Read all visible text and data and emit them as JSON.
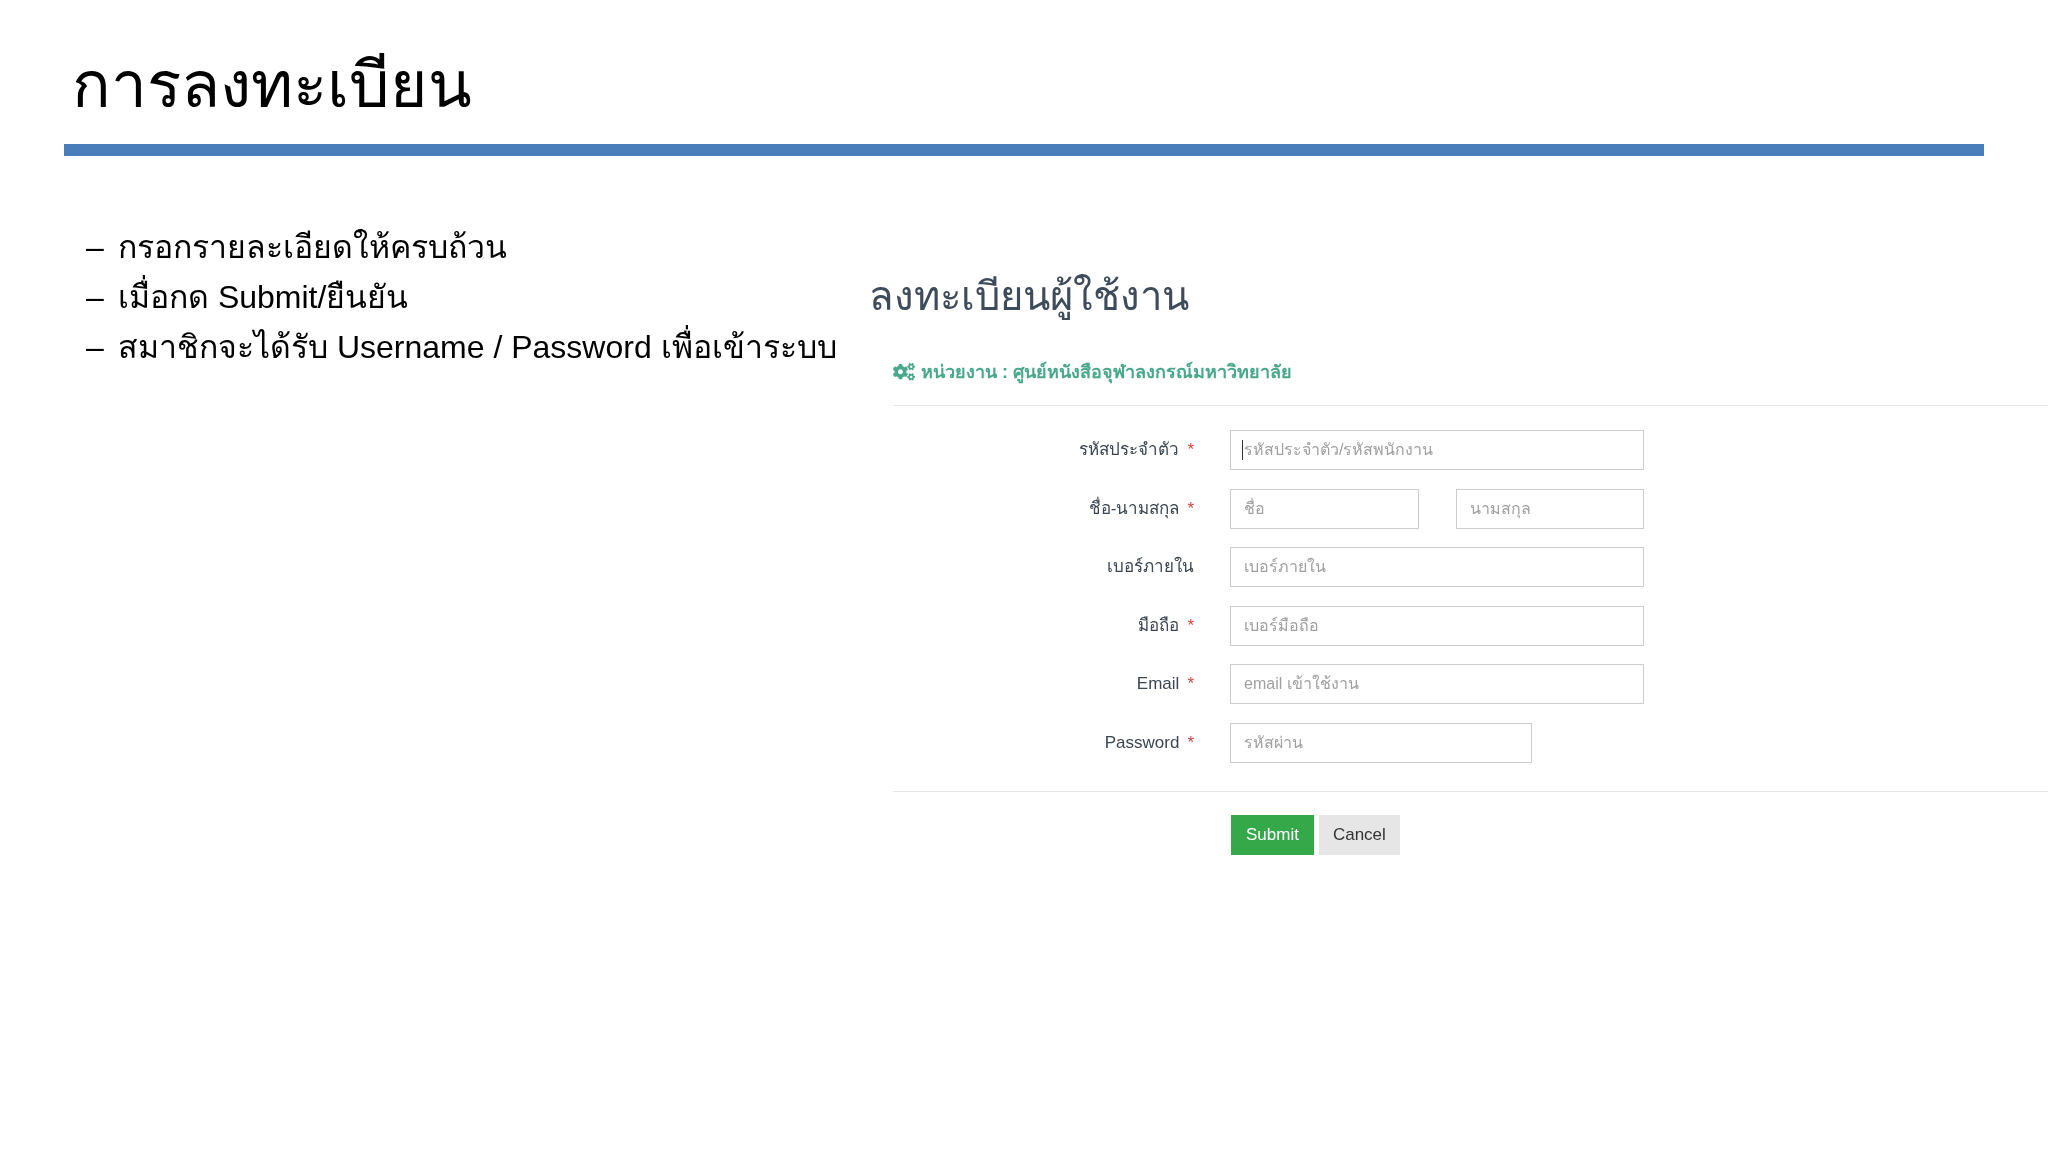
{
  "slide": {
    "title": "การลงทะเบียน"
  },
  "bullets": [
    {
      "marker": "–",
      "text": "กรอกรายละเอียดให้ครบถ้วน"
    },
    {
      "marker": "–",
      "text": "เมื่อกด Submit/ยืนยัน"
    },
    {
      "marker": "–",
      "text": "สมาชิกจะได้รับ Username / Password เพื่อเข้าระบบ"
    }
  ],
  "form": {
    "title": "ลงทะเบียนผู้ใช้งาน",
    "department": "หน่วยงาน : ศูนย์หนังสือจุฬาลงกรณ์มหาวิทยาลัย",
    "fields": [
      {
        "label": "รหัสประจำตัว",
        "required_mark": "*",
        "inputs": [
          {
            "kind": "text",
            "placeholder": "รหัสประจำตัว/รหัสพนักงาน",
            "focused": true
          }
        ]
      },
      {
        "label": "ชื่อ-นามสกุล",
        "required_mark": "*",
        "inputs": [
          {
            "kind": "text",
            "placeholder": "ชื่อ",
            "focused": false
          },
          {
            "kind": "text",
            "placeholder": "นามสกุล",
            "focused": false
          }
        ]
      },
      {
        "label": "เบอร์ภายใน",
        "inputs": [
          {
            "kind": "text",
            "placeholder": "เบอร์ภายใน",
            "focused": false
          }
        ]
      },
      {
        "label": "มือถือ",
        "required_mark": "*",
        "inputs": [
          {
            "kind": "text",
            "placeholder": "เบอร์มือถือ",
            "focused": false
          }
        ]
      },
      {
        "label": "Email",
        "required_mark": "*",
        "inputs": [
          {
            "kind": "text",
            "placeholder": "email เข้าใช้งาน",
            "focused": false
          }
        ]
      },
      {
        "label": "Password",
        "required_mark": "*",
        "inputs": [
          {
            "kind": "password",
            "placeholder": "รหัสผ่าน",
            "focused": false
          }
        ]
      }
    ],
    "buttons": [
      {
        "kind": "primary",
        "label": "Submit"
      },
      {
        "kind": "secondary",
        "label": "Cancel"
      }
    ]
  }
}
